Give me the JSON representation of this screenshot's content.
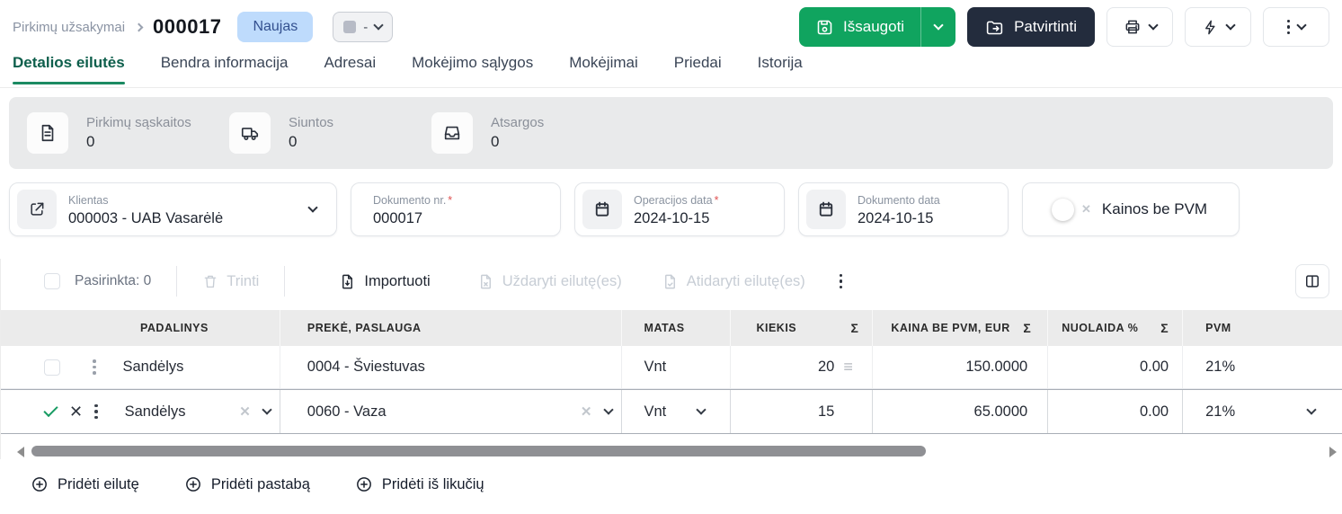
{
  "header": {
    "breadcrumb": "Pirkimų užsakymai",
    "title": "000017",
    "status_badge": "Naujas",
    "tag_value": "-",
    "save_label": "Išsaugoti",
    "confirm_label": "Patvirtinti"
  },
  "tabs": [
    {
      "label": "Detalios eilutės"
    },
    {
      "label": "Bendra informacija"
    },
    {
      "label": "Adresai"
    },
    {
      "label": "Mokėjimo sąlygos"
    },
    {
      "label": "Mokėjimai"
    },
    {
      "label": "Priedai"
    },
    {
      "label": "Istorija"
    }
  ],
  "stats": [
    {
      "icon": "invoice-document-icon",
      "label": "Pirkimų sąskaitos",
      "value": "0"
    },
    {
      "icon": "truck-icon",
      "label": "Siuntos",
      "value": "0"
    },
    {
      "icon": "inbox-tray-icon",
      "label": "Atsargos",
      "value": "0"
    }
  ],
  "fields": {
    "client": {
      "label": "Klientas",
      "value": "000003 - UAB Vasarėlė"
    },
    "document_no": {
      "label": "Dokumento nr.",
      "required": "*",
      "value": "000017"
    },
    "operation_date": {
      "label": "Operacijos data",
      "required": "*",
      "value": "2024-10-15"
    },
    "document_date": {
      "label": "Dokumento data",
      "value": "2024-10-15"
    },
    "prices_without_vat": {
      "label": "Kainos be PVM",
      "state": "off"
    }
  },
  "toolbar": {
    "selected_label": "Pasirinkta: 0",
    "delete_label": "Trinti",
    "import_label": "Importuoti",
    "close_lines_label": "Uždaryti eilutę(es)",
    "open_lines_label": "Atidaryti eilutę(es)"
  },
  "table": {
    "columns": [
      "PADALINYS",
      "PREKĖ, PASLAUGA",
      "MATAS",
      "KIEKIS",
      "KAINA BE PVM, EUR",
      "NUOLAIDA %",
      "PVM"
    ],
    "rows": [
      {
        "padalinys": "Sandėlys",
        "preke": "0004 - Šviestuvas",
        "matas": "Vnt",
        "kiekis": "20",
        "kaina": "150.0000",
        "nuolaida": "0.00",
        "pvm": "21%"
      },
      {
        "padalinys": "Sandėlys",
        "preke": "0060 - Vaza",
        "matas": "Vnt",
        "kiekis": "15",
        "kaina": "65.0000",
        "nuolaida": "0.00",
        "pvm": "21%",
        "state": "editing"
      }
    ]
  },
  "footer": {
    "add_row": "Pridėti eilutę",
    "add_note": "Pridėti pastabą",
    "add_from_stock": "Pridėti iš likučių"
  },
  "glyphs": {
    "sigma": "Σ",
    "drag": "≡",
    "clear": "✕",
    "dash": "-"
  },
  "colors": {
    "accent_green": "#10A45F",
    "dark_navy": "#232C3D",
    "badge_blue_bg": "#BEDBFC",
    "badge_blue_text": "#33508F",
    "active_tab_green": "#0E5F4C",
    "header_gray": "#EBEBEB"
  }
}
